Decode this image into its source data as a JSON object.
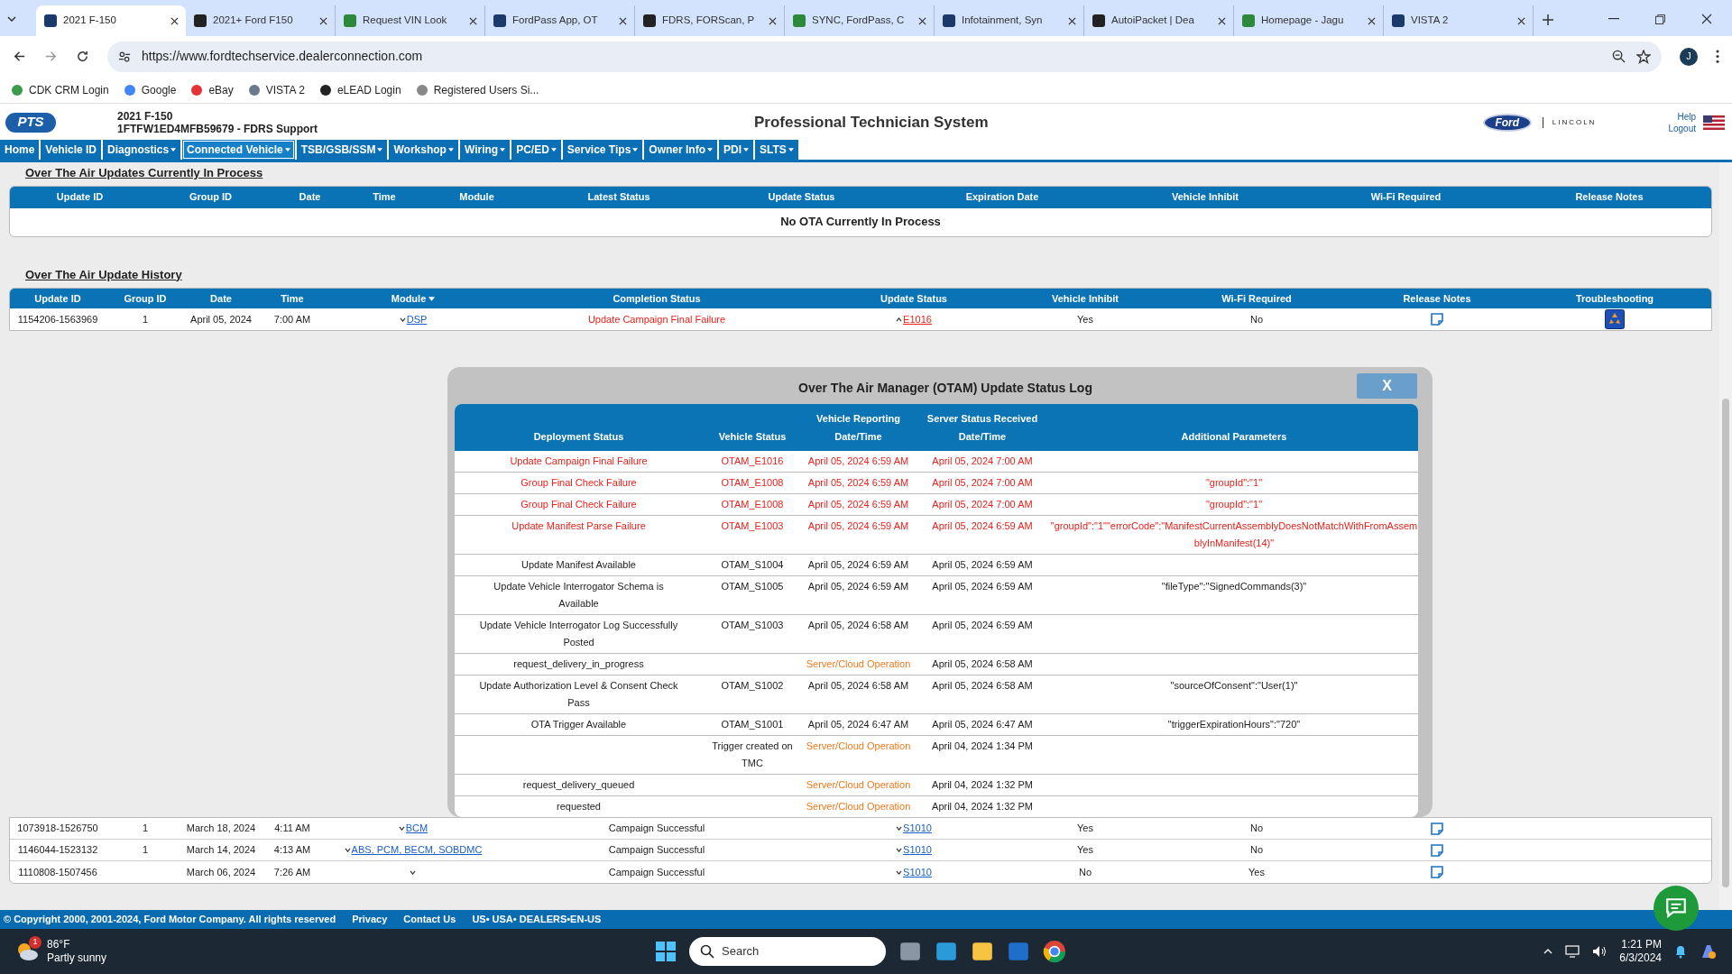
{
  "browser": {
    "tabs": [
      {
        "title": "2021 F-150",
        "selected": true
      },
      {
        "title": "2021+ Ford F150",
        "selected": false
      },
      {
        "title": "Request VIN Look",
        "selected": false
      },
      {
        "title": "FordPass App, OT",
        "selected": false
      },
      {
        "title": "FDRS, FORScan, P",
        "selected": false
      },
      {
        "title": "SYNC, FordPass, C",
        "selected": false
      },
      {
        "title": "Infotainment, Syn",
        "selected": false
      },
      {
        "title": "AutoiPacket | Dea",
        "selected": false
      },
      {
        "title": "Homepage - Jagu",
        "selected": false
      },
      {
        "title": "VISTA 2",
        "selected": false
      }
    ],
    "url": "https://www.fordtechservice.dealerconnection.com",
    "profile": "J",
    "bookmarks": [
      "CDK CRM Login",
      "Google",
      "eBay",
      "VISTA 2",
      "eLEAD Login",
      "Registered Users Si..."
    ]
  },
  "header": {
    "logo": "PTS",
    "vehicle": "2021 F-150",
    "vin_line": "1FTFW1ED4MFB59679 - FDRS Support",
    "title": "Professional Technician System",
    "brands": [
      "Ford",
      "LINCOLN"
    ],
    "links": [
      "Help",
      "Logout"
    ]
  },
  "nav": [
    {
      "label": "Home",
      "dropdown": false,
      "selected": false
    },
    {
      "label": "Vehicle ID",
      "dropdown": false,
      "selected": false
    },
    {
      "label": "Diagnostics",
      "dropdown": true,
      "selected": false
    },
    {
      "label": "Connected Vehicle",
      "dropdown": true,
      "selected": true
    },
    {
      "label": "TSB/GSB/SSM",
      "dropdown": true,
      "selected": false
    },
    {
      "label": "Workshop",
      "dropdown": true,
      "selected": false
    },
    {
      "label": "Wiring",
      "dropdown": true,
      "selected": false
    },
    {
      "label": "PC/ED",
      "dropdown": true,
      "selected": false
    },
    {
      "label": "Service Tips",
      "dropdown": true,
      "selected": false
    },
    {
      "label": "Owner Info",
      "dropdown": true,
      "selected": false
    },
    {
      "label": "PDI",
      "dropdown": true,
      "selected": false
    },
    {
      "label": "SLTS",
      "dropdown": true,
      "selected": false
    }
  ],
  "current": {
    "title": "Over The Air Updates Currently In Process",
    "columns": [
      "Update ID",
      "Group ID",
      "Date",
      "Time",
      "Module",
      "Latest Status",
      "Update Status",
      "Expiration Date",
      "Vehicle Inhibit",
      "Wi-Fi Required",
      "Release Notes"
    ],
    "empty_message": "No OTA Currently In Process"
  },
  "history": {
    "title": "Over The Air Update History",
    "columns": [
      {
        "label": "Update ID",
        "sortable": false
      },
      {
        "label": "Group ID",
        "sortable": false
      },
      {
        "label": "Date",
        "sortable": false
      },
      {
        "label": "Time",
        "sortable": false
      },
      {
        "label": "Module",
        "sortable": true
      },
      {
        "label": "Completion Status",
        "sortable": false
      },
      {
        "label": "Update Status",
        "sortable": false
      },
      {
        "label": "Vehicle Inhibit",
        "sortable": false
      },
      {
        "label": "Wi-Fi Required",
        "sortable": false
      },
      {
        "label": "Release Notes",
        "sortable": false
      },
      {
        "label": "Troubleshooting",
        "sortable": false
      }
    ],
    "rows": [
      {
        "id": "1154206-1563969",
        "group": "1",
        "date": "April 05, 2024",
        "time": "7:00 AM",
        "module": "DSP",
        "completion": "Update Campaign Final Failure",
        "failed": true,
        "status": "E1016",
        "status_expanded": true,
        "inhibit": "Yes",
        "wifi": "No",
        "troubleshooting": true
      },
      {
        "id": "1073918-1526750",
        "group": "1",
        "date": "March 18, 2024",
        "time": "4:11 AM",
        "module": "BCM",
        "completion": "Campaign Successful",
        "failed": false,
        "status": "S1010",
        "status_expanded": false,
        "inhibit": "Yes",
        "wifi": "No",
        "troubleshooting": false
      },
      {
        "id": "1146044-1523132",
        "group": "1",
        "date": "March 14, 2024",
        "time": "4:13 AM",
        "module": "ABS, PCM, BECM, SOBDMC",
        "completion": "Campaign Successful",
        "failed": false,
        "status": "S1010",
        "status_expanded": false,
        "inhibit": "Yes",
        "wifi": "No",
        "troubleshooting": false
      },
      {
        "id": "1110808-1507456",
        "date": "March 06, 2024",
        "time": "7:26 AM",
        "completion": "Campaign Successful",
        "failed": false,
        "status": "S1010",
        "status_expanded": false,
        "inhibit": "No",
        "wifi": "Yes",
        "troubleshooting": false
      }
    ]
  },
  "modal": {
    "title": "Over The Air Manager (OTAM) Update Status Log",
    "close": "X",
    "columns": [
      {
        "label": "Deployment Status"
      },
      {
        "label": "Vehicle Status"
      },
      {
        "overline": "Vehicle Reporting",
        "label": "Date/Time"
      },
      {
        "overline": "Server Status Received",
        "label": "Date/Time"
      },
      {
        "label": "Additional Parameters"
      }
    ],
    "rows": [
      {
        "deployment": "Update Campaign Final Failure",
        "vehicle_status": "OTAM_E1016",
        "reported": "April 05, 2024 6:59 AM",
        "server_side": false,
        "received": "April 05, 2024 7:00 AM",
        "failure": true
      },
      {
        "deployment": "Group Final Check Failure",
        "vehicle_status": "OTAM_E1008",
        "reported": "April 05, 2024 6:59 AM",
        "server_side": false,
        "received": "April 05, 2024 7:00 AM",
        "parameters": "\"groupId\":\"1\"",
        "failure": true
      },
      {
        "deployment": "Group Final Check Failure",
        "vehicle_status": "OTAM_E1008",
        "reported": "April 05, 2024 6:59 AM",
        "server_side": false,
        "received": "April 05, 2024 7:00 AM",
        "parameters": "\"groupId\":\"1\"",
        "failure": true
      },
      {
        "deployment": "Update Manifest Parse Failure",
        "vehicle_status": "OTAM_E1003",
        "reported": "April 05, 2024 6:59 AM",
        "server_side": false,
        "received": "April 05, 2024 6:59 AM",
        "parameters": "\"groupId\":\"1\"\"errorCode\":\"ManifestCurrentAssemblyDoesNotMatchWithFromAssemblyInManifest(14)\"",
        "failure": true
      },
      {
        "deployment": "Update Manifest Available",
        "vehicle_status": "OTAM_S1004",
        "reported": "April 05, 2024 6:59 AM",
        "server_side": false,
        "received": "April 05, 2024 6:59 AM",
        "failure": false
      },
      {
        "deployment": "Update Vehicle Interrogator Schema is Available",
        "vehicle_status": "OTAM_S1005",
        "reported": "April 05, 2024 6:59 AM",
        "server_side": false,
        "received": "April 05, 2024 6:59 AM",
        "parameters": "\"fileType\":\"SignedCommands(3)\"",
        "failure": false
      },
      {
        "deployment": "Update Vehicle Interrogator Log Successfully Posted",
        "vehicle_status": "OTAM_S1003",
        "reported": "April 05, 2024 6:58 AM",
        "server_side": false,
        "received": "April 05, 2024 6:59 AM",
        "failure": false
      },
      {
        "deployment": "request_delivery_in_progress",
        "reported": "Server/Cloud Operation",
        "server_side": true,
        "received": "April 05, 2024 6:58 AM",
        "failure": false
      },
      {
        "deployment": "Update Authorization Level & Consent Check Pass",
        "vehicle_status": "OTAM_S1002",
        "reported": "April 05, 2024 6:58 AM",
        "server_side": false,
        "received": "April 05, 2024 6:58 AM",
        "parameters": "\"sourceOfConsent\":\"User(1)\"",
        "failure": false
      },
      {
        "deployment": "OTA Trigger Available",
        "vehicle_status": "OTAM_S1001",
        "reported": "April 05, 2024 6:47 AM",
        "server_side": false,
        "received": "April 05, 2024 6:47 AM",
        "parameters": "\"triggerExpirationHours\":\"720\"",
        "failure": false
      },
      {
        "vehicle_status": "Trigger created on TMC",
        "reported": "Server/Cloud Operation",
        "server_side": true,
        "received": "April 04, 2024 1:34 PM",
        "failure": false
      },
      {
        "deployment": "request_delivery_queued",
        "reported": "Server/Cloud Operation",
        "server_side": true,
        "received": "April 04, 2024 1:32 PM",
        "failure": false
      },
      {
        "deployment": "requested",
        "reported": "Server/Cloud Operation",
        "server_side": true,
        "received": "April 04, 2024 1:32 PM",
        "failure": false
      }
    ]
  },
  "footer": {
    "copyright": "© Copyright 2000, 2001-2024, Ford Motor Company. All rights reserved",
    "links": [
      "Privacy",
      "Contact Us"
    ],
    "locale": "US• USA• DEALERS•EN-US"
  },
  "taskbar": {
    "weather": {
      "temp": "86°F",
      "condition": "Partly sunny",
      "badge": "1"
    },
    "search": "Search",
    "time": "1:21 PM",
    "date": "6/3/2024"
  }
}
